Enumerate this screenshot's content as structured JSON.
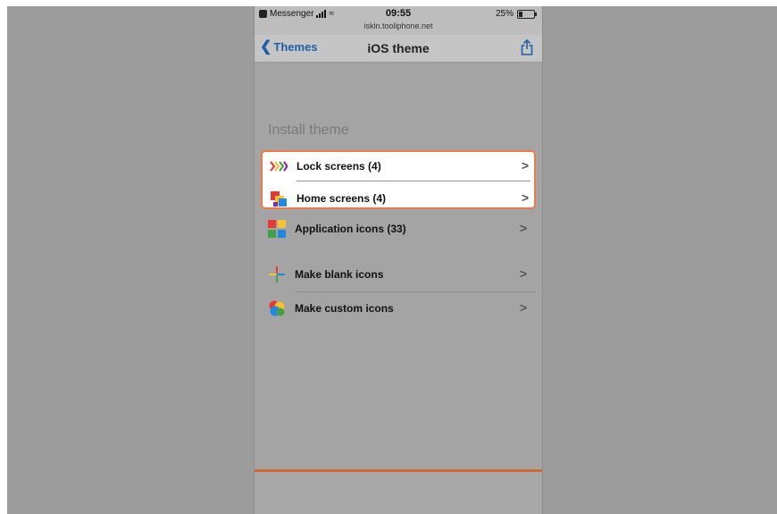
{
  "status_bar": {
    "carrier": "Messenger",
    "time": "09:55",
    "url": "iskin.tooliphone.net",
    "battery": "25%",
    "battery_level": 0.25
  },
  "nav": {
    "back_label": "Themes",
    "title": "iOS theme"
  },
  "section": {
    "title": "Install theme"
  },
  "menu": {
    "items": [
      {
        "label": "Lock screens (4)",
        "icon": "lock-screens-icon"
      },
      {
        "label": "Home screens (4)",
        "icon": "home-screens-icon"
      },
      {
        "label": "Application icons (33)",
        "icon": "application-icons-icon"
      },
      {
        "label": "Make blank icons",
        "icon": "make-blank-icons-icon"
      },
      {
        "label": "Make custom icons",
        "icon": "make-custom-icons-icon"
      }
    ],
    "arrow": ">"
  },
  "colors": {
    "highlight_border": "#f07a46",
    "link_blue": "#1e5fa8",
    "bottom_accent": "#d2692f"
  }
}
